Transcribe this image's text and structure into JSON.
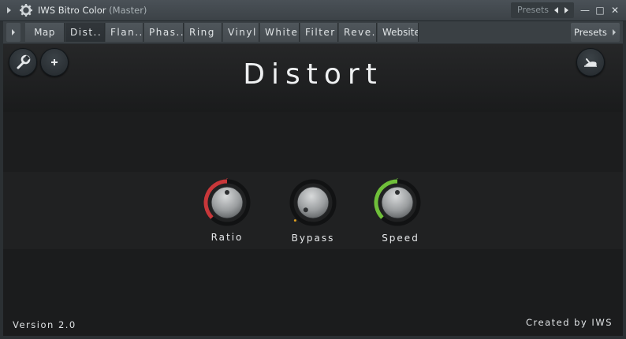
{
  "window": {
    "title": "IWS Bitro Color",
    "subtitle": "(Master)",
    "presets_label": "Presets",
    "minimize_glyph": "—",
    "maximize_glyph": "□",
    "close_glyph": "✕"
  },
  "tabs": [
    {
      "label": "Map",
      "active": false
    },
    {
      "label": "Dist..",
      "active": true
    },
    {
      "label": "Flan..",
      "active": false
    },
    {
      "label": "Phas..",
      "active": false
    },
    {
      "label": "Ring",
      "active": false
    },
    {
      "label": "Vinyl",
      "active": false
    },
    {
      "label": "White",
      "active": false
    },
    {
      "label": "Filter",
      "active": false
    },
    {
      "label": "Reve..",
      "active": false
    },
    {
      "label": "Website",
      "active": false
    }
  ],
  "tabbar_presets": "Presets",
  "plugin": {
    "title": "Distort",
    "icons": {
      "left1": "wrench-icon",
      "left2": "plus-icon",
      "right": "snail-icon"
    },
    "knobs": [
      {
        "label": "Ratio",
        "value": 0.5,
        "color": "#c8373a"
      },
      {
        "label": "Bypass",
        "value": 0.0,
        "color": "#e0a020"
      },
      {
        "label": "Speed",
        "value": 0.5,
        "color": "#6fbf3a"
      }
    ],
    "version": "Version 2.0",
    "credit": "Created by IWS"
  }
}
